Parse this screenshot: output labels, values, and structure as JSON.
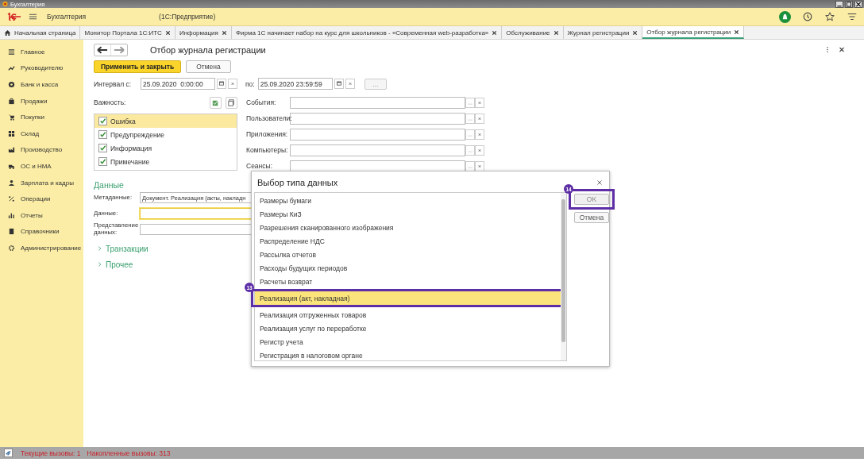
{
  "window": {
    "title": "Бухгалтерия"
  },
  "app_bar": {
    "title": "Бухгалтерия",
    "subtitle": "(1С:Предприятие)"
  },
  "tabs": [
    {
      "label": "Начальная страница",
      "kind": "home",
      "selected": false
    },
    {
      "label": "Монитор Портала 1С:ИТС",
      "kind": "closable",
      "selected": false
    },
    {
      "label": "Информация",
      "kind": "closable",
      "selected": false
    },
    {
      "label": "Фирма 1С начинает набор на курс для школьников - «Современная web-разработка»",
      "kind": "closable",
      "selected": false
    },
    {
      "label": "Обслуживание",
      "kind": "closable",
      "selected": false
    },
    {
      "label": "Журнал регистрации",
      "kind": "closable",
      "selected": false
    },
    {
      "label": "Отбор журнала регистрации",
      "kind": "closable",
      "selected": true
    }
  ],
  "sidebar": {
    "items": [
      {
        "label": "Главное"
      },
      {
        "label": "Руководителю"
      },
      {
        "label": "Банк и касса"
      },
      {
        "label": "Продажи"
      },
      {
        "label": "Покупки"
      },
      {
        "label": "Склад"
      },
      {
        "label": "Производство"
      },
      {
        "label": "ОС и НМА"
      },
      {
        "label": "Зарплата и кадры"
      },
      {
        "label": "Операции"
      },
      {
        "label": "Отчеты"
      },
      {
        "label": "Справочники"
      },
      {
        "label": "Администрирование"
      }
    ]
  },
  "form": {
    "title": "Отбор журнала регистрации",
    "buttons": [
      {
        "label": "Применить и закрыть",
        "kind": "primary"
      },
      {
        "label": "Отмена",
        "kind": "normal"
      }
    ],
    "interval": {
      "from_label": "Интервал с:",
      "from_value": "25.09.2020  0:00:00",
      "to_label": "по:",
      "to_value": "25.09.2020 23:59:59",
      "more": "..."
    },
    "importance": {
      "label": "Важность:",
      "items": [
        {
          "label": "Ошибка",
          "checked": true,
          "selected": true
        },
        {
          "label": "Предупреждение",
          "checked": true,
          "selected": false
        },
        {
          "label": "Информация",
          "checked": true,
          "selected": false
        },
        {
          "label": "Примечание",
          "checked": true,
          "selected": false
        }
      ]
    },
    "filters": [
      {
        "label": "События:"
      },
      {
        "label": "Пользователи:"
      },
      {
        "label": "Приложения:"
      },
      {
        "label": "Компьютеры:"
      },
      {
        "label": "Сеансы:"
      }
    ],
    "data_section": {
      "heading": "Данные",
      "fields": [
        {
          "label": "Метаданные:",
          "value": "Документ. Реализация (акты, накладн",
          "focused": false
        },
        {
          "label": "Данные:",
          "focused": true
        },
        {
          "label": "Представление данных:",
          "focused": false
        }
      ]
    },
    "groups": [
      {
        "label": "Транзакции",
        "expanded": false
      },
      {
        "label": "Прочее",
        "expanded": false
      }
    ]
  },
  "dialog": {
    "title": "Выбор типа данных",
    "items": [
      {
        "label": "Размеры бумаги",
        "selected": false
      },
      {
        "label": "Размеры КиЗ",
        "selected": false
      },
      {
        "label": "Разрешения сканированного изображения",
        "selected": false
      },
      {
        "label": "Распределение НДС",
        "selected": false
      },
      {
        "label": "Рассылка отчетов",
        "selected": false
      },
      {
        "label": "Расходы будущих периодов",
        "selected": false
      },
      {
        "label": "Расчеты возврат",
        "selected": false
      },
      {
        "label": "Реализация (акт, накладная)",
        "selected": true,
        "annotation": "13"
      },
      {
        "label": "Реализация отгруженных товаров",
        "selected": false
      },
      {
        "label": "Реализация услуг по переработке",
        "selected": false
      },
      {
        "label": "Регистр учета",
        "selected": false
      },
      {
        "label": "Регистрация в налоговом органе",
        "selected": false
      }
    ],
    "buttons": [
      {
        "label": "OK",
        "kind": "default",
        "annotation": "14"
      },
      {
        "label": "Отмена",
        "kind": "normal"
      }
    ]
  },
  "status_bar": {
    "current_calls": "Текущие вызовы: 1",
    "accumulated_calls": "Накопленные вызовы: 313"
  }
}
